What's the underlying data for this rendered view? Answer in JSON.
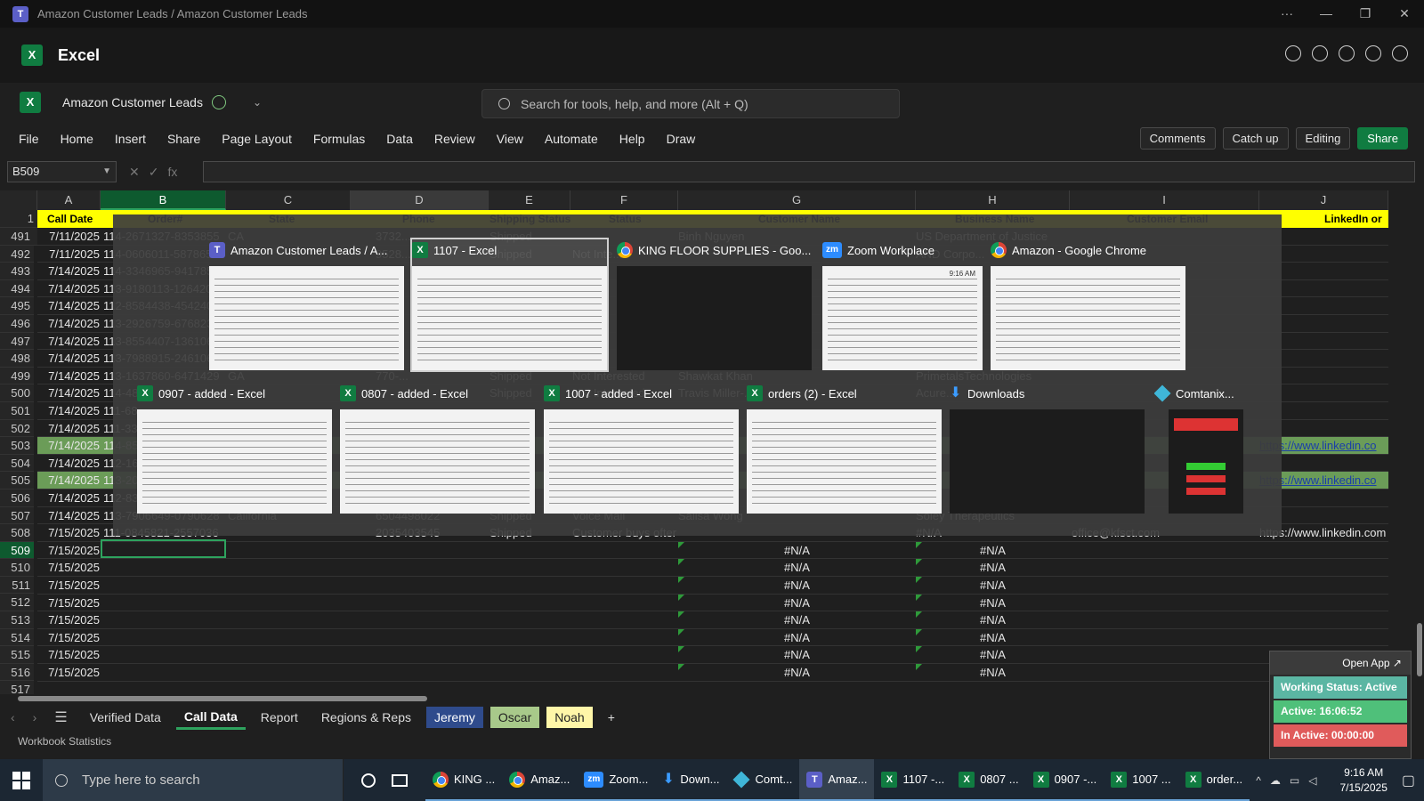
{
  "titlebar": {
    "title": "Amazon Customer Leads / Amazon Customer Leads",
    "more": "···",
    "minimize": "—",
    "maximize": "❐",
    "close": "✕"
  },
  "app": {
    "name": "Excel",
    "logo": "X"
  },
  "file": {
    "name": "Amazon Customer Leads"
  },
  "search": {
    "placeholder": "Search for tools, help, and more (Alt + Q)"
  },
  "menu": {
    "items": [
      "File",
      "Home",
      "Insert",
      "Share",
      "Page Layout",
      "Formulas",
      "Data",
      "Review",
      "View",
      "Automate",
      "Help",
      "Draw"
    ],
    "comments": "Comments",
    "catchup": "Catch up",
    "editing": "Editing",
    "share": "Share"
  },
  "formula": {
    "namebox": "B509",
    "fx": "fx"
  },
  "columns": [
    "A",
    "B",
    "C",
    "D",
    "E",
    "F",
    "G",
    "H",
    "I",
    "J"
  ],
  "header_row": {
    "num": "1",
    "cells": [
      "Call Date",
      "Order#",
      "State",
      "Phone",
      "Shipping Status",
      "Status",
      "Customer Name",
      "Business Name",
      "Customer Email",
      "LinkedIn or"
    ]
  },
  "row_numbers": [
    "491",
    "492",
    "493",
    "494",
    "495",
    "496",
    "497",
    "498",
    "499",
    "500",
    "501",
    "502",
    "503",
    "504",
    "505",
    "506",
    "507",
    "508",
    "509",
    "510",
    "511",
    "512",
    "513",
    "514",
    "515",
    "516",
    "517"
  ],
  "rows": [
    {
      "a": "7/11/2025",
      "b": "114-2671327-8353855",
      "c": "CA",
      "d": "3732...",
      "e": "Shipped",
      "f": "",
      "g": "Binh Nguyen",
      "h": "US Department of Justice",
      "i": "",
      "j": ""
    },
    {
      "a": "7/11/2025",
      "b": "114-0606011-5878654",
      "c": "",
      "d": "9528...",
      "e": "Shipped",
      "f": "Not Inte...",
      "g": "",
      "h": "AND Corpo...",
      "i": "",
      "j": ""
    },
    {
      "a": "7/14/2025",
      "b": "114-3346965-9417854",
      "c": "",
      "d": "",
      "e": "",
      "f": "",
      "g": "",
      "h": "",
      "i": "",
      "j": ""
    },
    {
      "a": "7/14/2025",
      "b": "113-9180113-1264208",
      "c": "",
      "d": "",
      "e": "",
      "f": "",
      "g": "",
      "h": "",
      "i": "",
      "j": ""
    },
    {
      "a": "7/14/2025",
      "b": "112-8584438-4542407",
      "c": "",
      "d": "",
      "e": "",
      "f": "",
      "g": "",
      "h": "",
      "i": "",
      "j": ""
    },
    {
      "a": "7/14/2025",
      "b": "113-2926759-6768231",
      "c": "",
      "d": "",
      "e": "",
      "f": "",
      "g": "",
      "h": "",
      "i": "",
      "j": ""
    },
    {
      "a": "7/14/2025",
      "b": "113-8554407-1361063",
      "c": "",
      "d": "",
      "e": "",
      "f": "",
      "g": "",
      "h": "",
      "i": "",
      "j": ""
    },
    {
      "a": "7/14/2025",
      "b": "113-7988915-2461068",
      "c": "",
      "d": "",
      "e": "",
      "f": "",
      "g": "",
      "h": "",
      "i": "",
      "j": ""
    },
    {
      "a": "7/14/2025",
      "b": "113-1637860-6471429",
      "c": "GA",
      "d": "770-...",
      "e": "Shipped",
      "f": "Not Interested",
      "g": "Shawkat Khan",
      "h": "PrimetalsTechnologies",
      "i": "",
      "j": ""
    },
    {
      "a": "7/14/2025",
      "b": "114-48...",
      "c": "",
      "d": "",
      "e": "Shipped",
      "f": "Not Interested",
      "g": "Travis Miller-...",
      "h": "Acure...",
      "i": "",
      "j": ""
    },
    {
      "a": "7/14/2025",
      "b": "111-68...",
      "c": "",
      "d": "",
      "e": "",
      "f": "",
      "g": "",
      "h": "",
      "i": "",
      "j": ""
    },
    {
      "a": "7/14/2025",
      "b": "111-33...",
      "c": "",
      "d": "",
      "e": "",
      "f": "",
      "g": "",
      "h": "",
      "i": "",
      "j": ""
    },
    {
      "a": "7/14/2025",
      "b": "114-85...",
      "c": "",
      "d": "",
      "e": "",
      "f": "",
      "g": "",
      "h": "",
      "i": "",
      "j": "https://www.linkedin.co"
    },
    {
      "a": "7/14/2025",
      "b": "112-16...",
      "c": "",
      "d": "",
      "e": "",
      "f": "",
      "g": "",
      "h": "",
      "i": "",
      "j": ""
    },
    {
      "a": "7/14/2025",
      "b": "113-20...",
      "c": "",
      "d": "",
      "e": "",
      "f": "",
      "g": "",
      "h": "",
      "i": "",
      "j": "https://www.linkedin.co"
    },
    {
      "a": "7/14/2025",
      "b": "112-83...",
      "c": "",
      "d": "",
      "e": "",
      "f": "",
      "g": "",
      "h": "",
      "i": "",
      "j": ""
    },
    {
      "a": "7/14/2025",
      "b": "113-7906649-0790628",
      "c": "California",
      "d": "6504498022",
      "e": "Shipped",
      "f": "Voice Mail",
      "g": "Salisa Wong",
      "h": "Soley Therapeutics",
      "i": "",
      "j": ""
    },
    {
      "a": "7/15/2025",
      "b": "111-0845821-2557036",
      "c": "",
      "d": "2035403545",
      "e": "Shipped",
      "f": "Customer buys ofter",
      "g": "",
      "h": "#N/A",
      "i": "office@kfsct.com",
      "j": "https://www.linkedin.com"
    },
    {
      "a": "7/15/2025",
      "b": "",
      "c": "",
      "d": "",
      "e": "",
      "f": "",
      "g": "#N/A",
      "h": "#N/A",
      "i": "",
      "j": ""
    },
    {
      "a": "7/15/2025",
      "b": "",
      "c": "",
      "d": "",
      "e": "",
      "f": "",
      "g": "#N/A",
      "h": "#N/A",
      "i": "",
      "j": ""
    },
    {
      "a": "7/15/2025",
      "b": "",
      "c": "",
      "d": "",
      "e": "",
      "f": "",
      "g": "#N/A",
      "h": "#N/A",
      "i": "",
      "j": ""
    },
    {
      "a": "7/15/2025",
      "b": "",
      "c": "",
      "d": "",
      "e": "",
      "f": "",
      "g": "#N/A",
      "h": "#N/A",
      "i": "",
      "j": ""
    },
    {
      "a": "7/15/2025",
      "b": "",
      "c": "",
      "d": "",
      "e": "",
      "f": "",
      "g": "#N/A",
      "h": "#N/A",
      "i": "",
      "j": ""
    },
    {
      "a": "7/15/2025",
      "b": "",
      "c": "",
      "d": "",
      "e": "",
      "f": "",
      "g": "#N/A",
      "h": "#N/A",
      "i": "",
      "j": ""
    },
    {
      "a": "7/15/2025",
      "b": "",
      "c": "",
      "d": "",
      "e": "",
      "f": "",
      "g": "#N/A",
      "h": "#N/A",
      "i": "",
      "j": ""
    },
    {
      "a": "7/15/2025",
      "b": "",
      "c": "",
      "d": "",
      "e": "",
      "f": "",
      "g": "#N/A",
      "h": "#N/A",
      "i": "",
      "j": ""
    }
  ],
  "switcher": {
    "top": [
      {
        "title": "Amazon Customer Leads / A...",
        "icon": "teams-icon"
      },
      {
        "title": "1107 - Excel",
        "icon": "excel-icon"
      },
      {
        "title": "KING FLOOR SUPPLIES - Goo...",
        "icon": "chrome-icon"
      },
      {
        "title": "Zoom Workplace",
        "icon": "zoom-icon"
      },
      {
        "title": "Amazon - Google Chrome",
        "icon": "chrome-icon"
      }
    ],
    "bottom": [
      {
        "title": "0907 - added - Excel",
        "icon": "excel-icon"
      },
      {
        "title": "0807 - added - Excel",
        "icon": "excel-icon"
      },
      {
        "title": "1007 - added - Excel",
        "icon": "excel-icon"
      },
      {
        "title": "orders (2) - Excel",
        "icon": "excel-icon"
      },
      {
        "title": "Downloads",
        "icon": "download-icon"
      },
      {
        "title": "Comtanix...",
        "icon": "comtanix-icon"
      }
    ],
    "zoom_clock": "9:16 AM"
  },
  "sheets": {
    "tabs": [
      "Verified Data",
      "Call Data",
      "Report",
      "Regions & Reps",
      "Jeremy",
      "Oscar",
      "Noah"
    ],
    "add": "+"
  },
  "status": {
    "left": "Workbook Statistics"
  },
  "widget": {
    "open": "Open App ↗",
    "status": "Working Status: Active",
    "active": "Active: 16:06:52",
    "inactive": "In Active: 00:00:00"
  },
  "taskbar": {
    "search": "Type here to search",
    "apps": [
      {
        "label": "KING ...",
        "icon": "chrome-icon"
      },
      {
        "label": "Amaz...",
        "icon": "chrome-icon"
      },
      {
        "label": "Zoom...",
        "icon": "zoom-icon"
      },
      {
        "label": "Down...",
        "icon": "download-icon"
      },
      {
        "label": "Comt...",
        "icon": "comtanix-icon"
      },
      {
        "label": "Amaz...",
        "icon": "teams-icon"
      },
      {
        "label": "1107 -...",
        "icon": "excel-icon"
      },
      {
        "label": "0807 ...",
        "icon": "excel-icon"
      },
      {
        "label": "0907 -...",
        "icon": "excel-icon"
      },
      {
        "label": "1007 ...",
        "icon": "excel-icon"
      },
      {
        "label": "order...",
        "icon": "excel-icon"
      }
    ],
    "time": "9:16 AM",
    "date": "7/15/2025"
  },
  "colors": {
    "accent": "#107c41",
    "header_yellow": "#ffff00",
    "row_green": "#6b9c58",
    "widget_teal": "#5bb6a3",
    "widget_green": "#4fc07a",
    "widget_red": "#e05b5b"
  }
}
